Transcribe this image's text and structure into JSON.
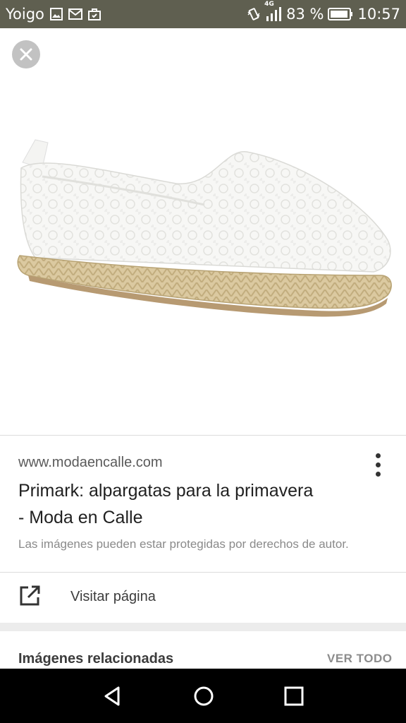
{
  "status_bar": {
    "carrier": "Yoigo",
    "network": "4G",
    "battery": "83 %",
    "time": "10:57",
    "icons": [
      "image-icon",
      "mail-icon",
      "bag-icon",
      "vibrate-icon",
      "signal-icon",
      "battery-icon"
    ]
  },
  "image_viewer": {
    "close_icon": "close-icon",
    "image_subject": "white lace espadrille shoe"
  },
  "result": {
    "source_url": "www.modaencalle.com",
    "title_line1": "Primark: alpargatas para la primavera",
    "title_line2": "- Moda en Calle",
    "copyright_notice": "Las imágenes pueden estar protegidas por derechos de autor.",
    "visit_label": "Visitar página"
  },
  "related": {
    "title": "Imágenes relacionadas",
    "view_all": "VER TODO"
  },
  "nav_bar": {
    "buttons": [
      "back-icon",
      "home-icon",
      "recents-icon"
    ]
  },
  "colors": {
    "status_bar_bg": "#5f5f50",
    "nav_bar_bg": "#000000",
    "text_primary": "#212121",
    "text_secondary": "#8a8a8a"
  }
}
